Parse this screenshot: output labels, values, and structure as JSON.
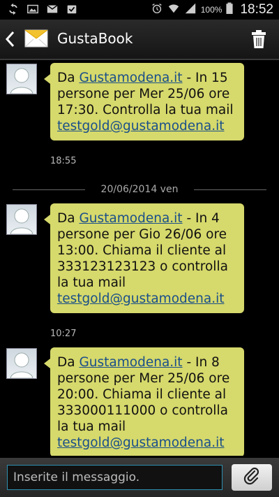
{
  "status_bar": {
    "icons_left": [
      "sync-icon",
      "image-icon",
      "gmail-icon",
      "task-check-icon"
    ],
    "icons_right": [
      "alarm-icon",
      "wifi-icon",
      "signal-icon"
    ],
    "battery": "100%",
    "time": "18:52"
  },
  "app_bar": {
    "title": "GustaBook"
  },
  "messages": [
    {
      "prefix": "Da ",
      "link": "Gustamodena.it",
      "body": " - In 15 persone per Mer 25/06 ore 17:30. Controlla la tua mail ",
      "email": "testgold@gustamodena.it",
      "time": "18:55"
    },
    {
      "prefix": "Da ",
      "link": "Gustamodena.it",
      "body": " - In 4 persone per Gio 26/06 ore 13:00. Chiama il cliente al 333123123123 o controlla la tua mail ",
      "email": "testgold@gustamodena.it",
      "time": "10:27"
    },
    {
      "prefix": "Da ",
      "link": "Gustamodena.it",
      "body": " - In 8 persone per Mer 25/06 ore 20:00. Chiama il cliente al 333000111000 o controlla la tua mail ",
      "email": "testgold@gustamodena.it",
      "time": ""
    }
  ],
  "date_separator": "20/06/2014 ven",
  "composer": {
    "placeholder": "Inserite il messaggio."
  },
  "colors": {
    "bubble": "#d6d96b",
    "link": "#1a4f8a",
    "accent": "#2e8fb0"
  }
}
